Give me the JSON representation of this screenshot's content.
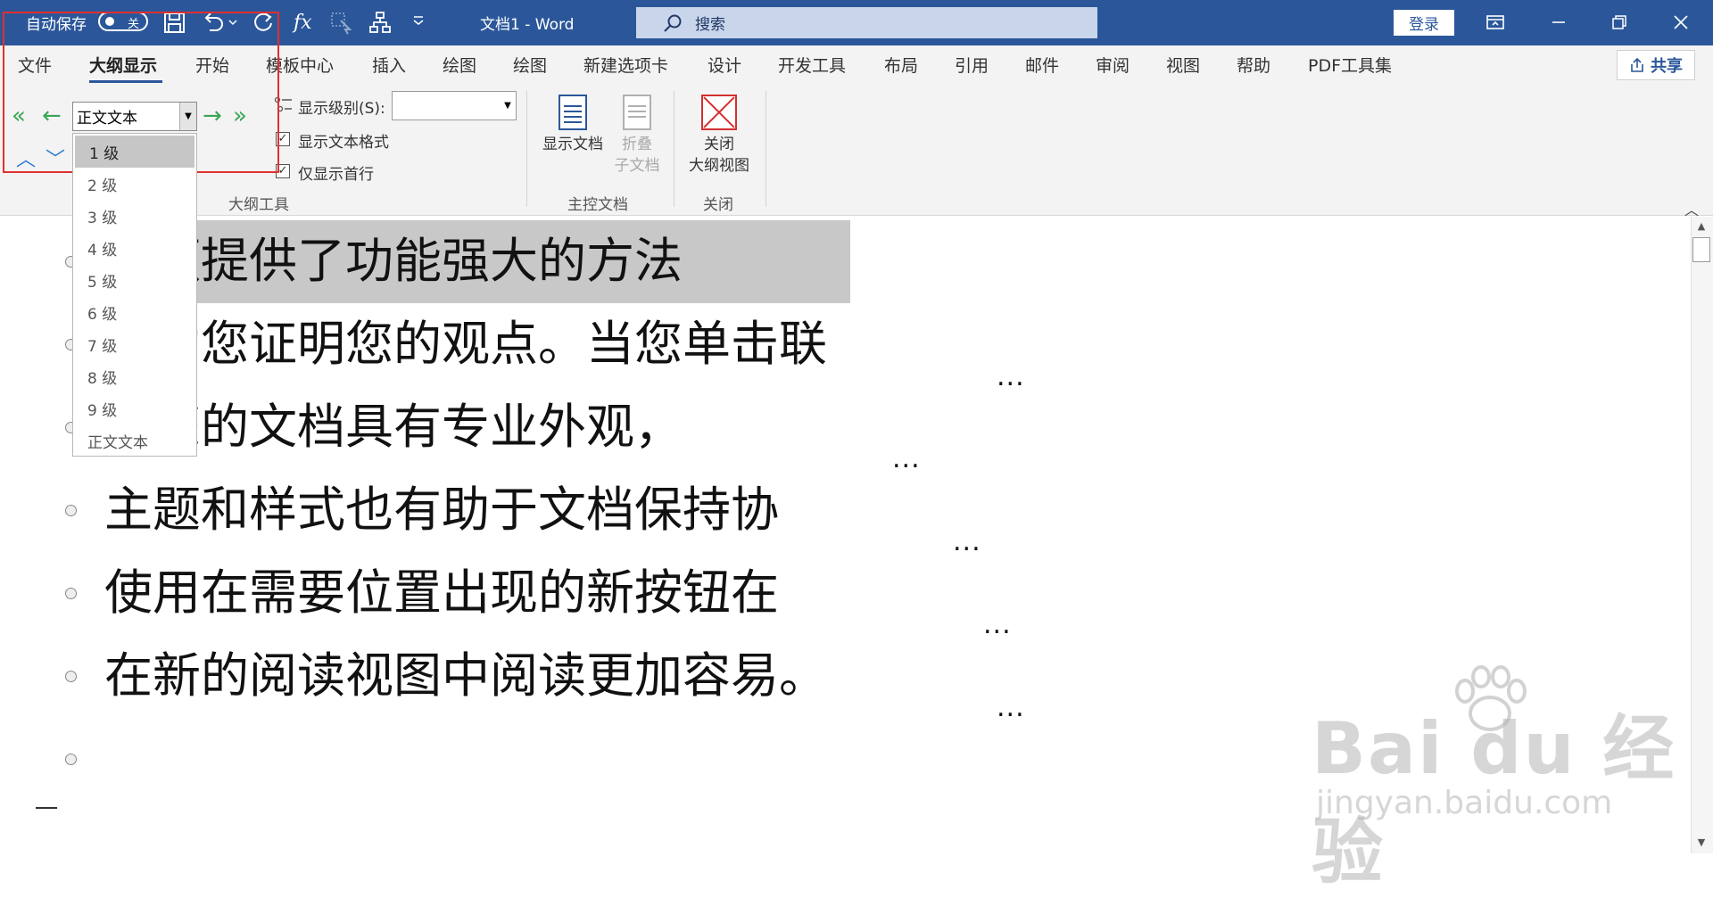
{
  "titlebar": {
    "autosave_label": "自动保存",
    "autosave_state": "关",
    "doc_title": "文档1  -  Word",
    "search_placeholder": "搜索",
    "login": "登录",
    "icons": [
      "save-icon",
      "undo-icon",
      "redo-icon",
      "fx-icon",
      "select-icon",
      "org-chart-icon",
      "customize-icon",
      "ribbon-display-icon",
      "minimize-icon",
      "restore-icon",
      "close-icon"
    ]
  },
  "tabs": [
    "文件",
    "大纲显示",
    "开始",
    "模板中心",
    "插入",
    "绘图",
    "绘图",
    "新建选项卡",
    "设计",
    "开发工具",
    "布局",
    "引用",
    "邮件",
    "审阅",
    "视图",
    "帮助",
    "PDF工具集"
  ],
  "active_tab": "大纲显示",
  "share_label": "共享",
  "outline_tools": {
    "level_combo_value": "正文文本",
    "show_level_label": "显示级别(S):",
    "show_level_value": "",
    "show_text_format": "显示文本格式",
    "show_text_format_checked": true,
    "show_first_line": "仅显示首行",
    "show_first_line_checked": true,
    "group_label": "大纲工具"
  },
  "master_doc": {
    "show_doc": "显示文档",
    "collapse_line1": "折叠",
    "collapse_line2": "子文档",
    "group_label": "主控文档"
  },
  "close_group": {
    "btn_line1": "关闭",
    "btn_line2": "大纲视图",
    "group_label": "关闭"
  },
  "dropdown": {
    "items": [
      "1 级",
      "2 级",
      "3 级",
      "4 级",
      "5 级",
      "6 级",
      "7 级",
      "8 级",
      "9 级",
      "正文文本"
    ],
    "selected_index": 0
  },
  "document": {
    "lines": [
      "视频提供了功能强大的方法",
      "帮助您证明您的观点。当您单击联",
      "使您的文档具有专业外观，",
      "主题和样式也有助于文档保持协",
      "使用在需要位置出现的新按钮在",
      "在新的阅读视图中阅读更加容易。"
    ],
    "ellipsis": "..."
  },
  "watermark": {
    "brand": "Bai du 经验",
    "url": "jingyan.baidu.com"
  }
}
